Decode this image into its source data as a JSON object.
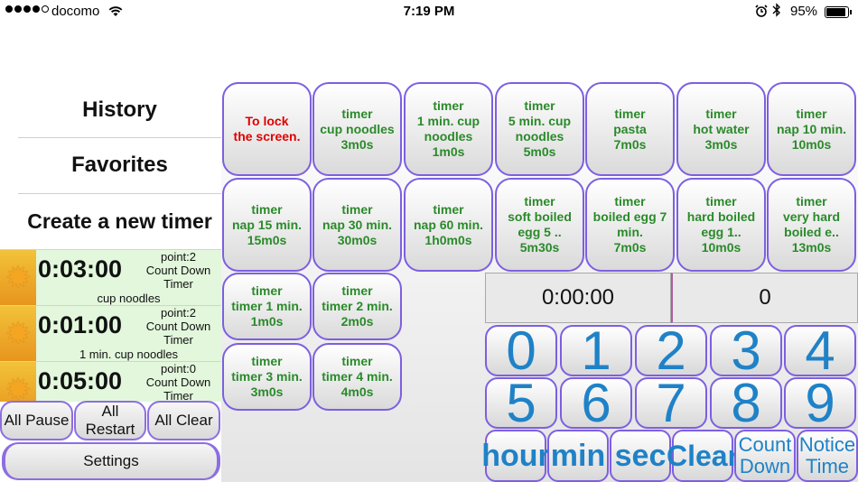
{
  "status_bar": {
    "carrier": "docomo",
    "time": "7:19 PM",
    "battery": "95%",
    "signal_bars": 4
  },
  "menu": {
    "history": "History",
    "favorites": "Favorites",
    "create": "Create a new timer"
  },
  "running_timers": [
    {
      "time": "0:03:00",
      "point": "point:2",
      "mode": "Count Down",
      "type": "Timer",
      "name": "cup noodles"
    },
    {
      "time": "0:01:00",
      "point": "point:2",
      "mode": "Count Down",
      "type": "Timer",
      "name": "1 min. cup noodles"
    },
    {
      "time": "0:05:00",
      "point": "point:0",
      "mode": "Count Down",
      "type": "Timer",
      "name": ""
    }
  ],
  "controls": {
    "all_pause": "All Pause",
    "all_restart_1": "All",
    "all_restart_2": "Restart",
    "all_clear": "All Clear",
    "settings": "Settings"
  },
  "timer_buttons": [
    {
      "l1": "To lock",
      "l2": "the screen.",
      "l3": "",
      "l4": ""
    },
    {
      "l1": "timer",
      "l2": "cup noodles",
      "l3": "3m0s",
      "l4": ""
    },
    {
      "l1": "timer",
      "l2": "1 min. cup",
      "l3": "noodles",
      "l4": "1m0s"
    },
    {
      "l1": "timer",
      "l2": "5 min. cup",
      "l3": "noodles",
      "l4": "5m0s"
    },
    {
      "l1": "timer",
      "l2": "pasta",
      "l3": "7m0s",
      "l4": ""
    },
    {
      "l1": "timer",
      "l2": "hot water",
      "l3": "3m0s",
      "l4": ""
    },
    {
      "l1": "timer",
      "l2": "nap 10 min.",
      "l3": "10m0s",
      "l4": ""
    },
    {
      "l1": "timer",
      "l2": "nap 15 min.",
      "l3": "15m0s",
      "l4": ""
    },
    {
      "l1": "timer",
      "l2": "nap 30 min.",
      "l3": "30m0s",
      "l4": ""
    },
    {
      "l1": "timer",
      "l2": "nap 60 min.",
      "l3": "1h0m0s",
      "l4": ""
    },
    {
      "l1": "timer",
      "l2": "soft boiled",
      "l3": "egg 5 ..",
      "l4": "5m30s"
    },
    {
      "l1": "timer",
      "l2": "boiled egg 7",
      "l3": "min.",
      "l4": "7m0s"
    },
    {
      "l1": "timer",
      "l2": "hard boiled",
      "l3": "egg 1..",
      "l4": "10m0s"
    },
    {
      "l1": "timer",
      "l2": "very hard",
      "l3": "boiled e..",
      "l4": "13m0s"
    },
    {
      "l1": "timer",
      "l2": "timer 1 min.",
      "l3": "1m0s",
      "l4": ""
    },
    {
      "l1": "timer",
      "l2": "timer 2 min.",
      "l3": "2m0s",
      "l4": ""
    },
    {
      "l1": "timer",
      "l2": "timer 3 min.",
      "l3": "3m0s",
      "l4": ""
    },
    {
      "l1": "timer",
      "l2": "timer 4 min.",
      "l3": "4m0s",
      "l4": ""
    }
  ],
  "input": {
    "time_display": "0:00:00",
    "count_display": "0"
  },
  "keypad": [
    "0",
    "1",
    "2",
    "3",
    "4",
    "5",
    "6",
    "7",
    "8",
    "9"
  ],
  "unit_buttons": {
    "hour": "hour",
    "min": "min",
    "sec": "sec",
    "clear": "Clear",
    "count_down_1": "Count",
    "count_down_2": "Down",
    "notice_time_1": "Notice",
    "notice_time_2": "Time"
  },
  "colors": {
    "accent_border": "#7d5fe0",
    "timer_text": "#2a8a2a",
    "lock_text": "#e00000",
    "keypad_text": "#1f82c7",
    "row_bg": "#e2f7dc"
  }
}
